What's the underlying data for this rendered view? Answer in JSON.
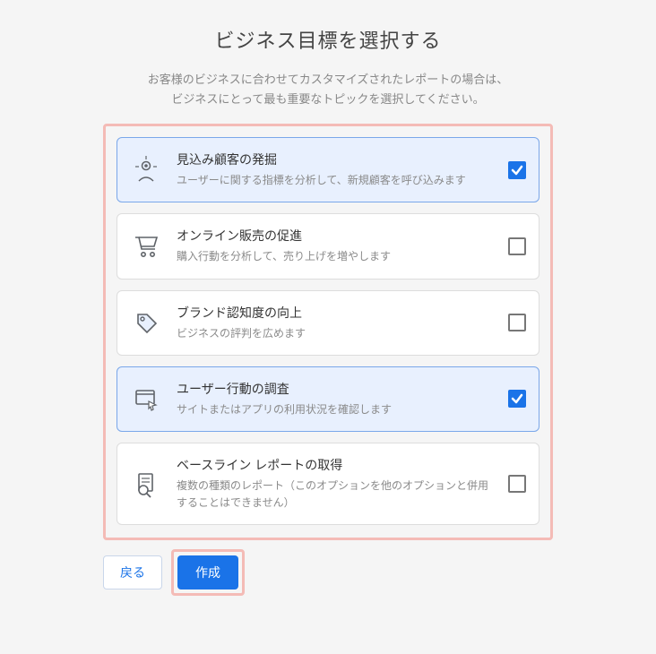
{
  "title": "ビジネス目標を選択する",
  "subtitle_line1": "お客様のビジネスに合わせてカスタマイズされたレポートの場合は、",
  "subtitle_line2": "ビジネスにとって最も重要なトピックを選択してください。",
  "options": [
    {
      "title": "見込み顧客の発掘",
      "desc": "ユーザーに関する指標を分析して、新規顧客を呼び込みます",
      "selected": true,
      "icon": "person-target-icon"
    },
    {
      "title": "オンライン販売の促進",
      "desc": "購入行動を分析して、売り上げを増やします",
      "selected": false,
      "icon": "cart-icon"
    },
    {
      "title": "ブランド認知度の向上",
      "desc": "ビジネスの評判を広めます",
      "selected": false,
      "icon": "tag-icon"
    },
    {
      "title": "ユーザー行動の調査",
      "desc": "サイトまたはアプリの利用状況を確認します",
      "selected": true,
      "icon": "window-cursor-icon"
    },
    {
      "title": "ベースライン レポートの取得",
      "desc": "複数の種類のレポート（このオプションを他のオプションと併用することはできません）",
      "selected": false,
      "icon": "report-magnify-icon"
    }
  ],
  "buttons": {
    "back": "戻る",
    "create": "作成"
  }
}
